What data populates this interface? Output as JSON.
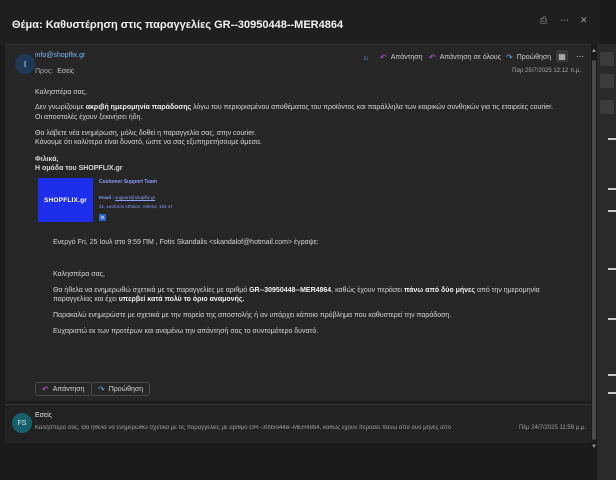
{
  "subject": "Θέμα: Καθυστέρηση στις παραγγελίες GR--30950448--MER4864",
  "message": {
    "avatar_initial": "I",
    "from": "info@shopflix.gr",
    "to_label": "Προς:",
    "to": "Εσείς",
    "date": "Παρ 25/7/2025 12:12 π.μ.",
    "actions": {
      "reply": "Απάντηση",
      "reply_all": "Απάντηση σε όλους",
      "forward": "Προώθηση"
    },
    "body": {
      "greeting": "Καλησπέρα σας,",
      "p1_prefix": "Δεν γνωρίζουμε ",
      "p1_bold": "ακριβή ημερομηνία παράδοσης",
      "p1_suffix": " λόγω του περιορισμένου αποθέματος του προϊόντος και παράλληλα των καιρικών συνθηκών για τις εταιρείες courier.",
      "p1_line2": "Οι αποστολές έχουν ξεκινήσει ήδη.",
      "p2_line1": "Θα λάβετε νέα ενημέρωση, μόλις δοθεί η παραγγελία σας, στην courier.",
      "p2_line2": "Κάνουμε ότι καλύτερο είναι δυνατό, ώστε να σας εξυπηρετήσουμε άμεσα.",
      "sign1": "Φιλικά,",
      "sign2": "Η ομάδα του SHOPFLIX.gr"
    },
    "signature": {
      "logo_text": "SHOPFLIX.gr",
      "team": "Customer Support Team",
      "email_label": "Email : ",
      "email": "support@shopflix.gr",
      "address": "31, Leoforos Athinon, Athens, 104 47",
      "linkedin": "in"
    },
    "quoted": {
      "header": "Ενεργό Fri, 25 Ιουλ στο 9:59 ΠΜ , Fotis Skandalis <skandalof@hotmail.com> έγραψε:",
      "greeting": "Καλησπέρα σας,",
      "p1_a": "Θα ήθελα να ενημερωθώ σχετικά με τις παραγγελίες με αριθμό ",
      "p1_bold1": "GR--30950448--MER4864",
      "p1_b": ", καθώς έχουν περάσει ",
      "p1_bold2": "πάνω από δύο μήνες",
      "p1_c": " από την ημερομηνία",
      "p1_line2_a": "παραγγελίας και έχει ",
      "p1_line2_bold": "υπερβεί κατά πολύ το όριο αναμονής.",
      "p2": "Παρακαλώ ενημερώστε με σχετικά με την πορεία της αποστολής ή αν υπάρχει κάποιο πρόβλημα που καθυστερεί την παράδοση.",
      "p3": "Ευχαριστώ εκ των προτέρων και αναμένω την απάντησή σας το συντομότερο δυνατό."
    },
    "footer": {
      "reply": "Απάντηση",
      "forward": "Προώθηση"
    }
  },
  "thread_item": {
    "initials": "FS",
    "name": "Εσείς",
    "preview": "Καλησπέρα σας, Θα ήθελα να ενημερωθώ σχετικά με τις παραγγελίες με αριθμό GR--30950448--MER4864, καθώς έχουν περάσει πάνω από δύο μήνες από",
    "date": "Πέμ 24/7/2025 11:59 μ.μ."
  },
  "icons": {
    "reply": "reply-icon",
    "reply_all": "reply-all-icon",
    "forward": "forward-icon",
    "brightness": "sun-icon",
    "grid": "grid-view-icon",
    "more": "more-icon",
    "linkedin": "linkedin-icon"
  },
  "colors": {
    "link": "#7fb8f2",
    "reply_accent": "#c05be0",
    "brand_blue": "#1c2eea"
  }
}
